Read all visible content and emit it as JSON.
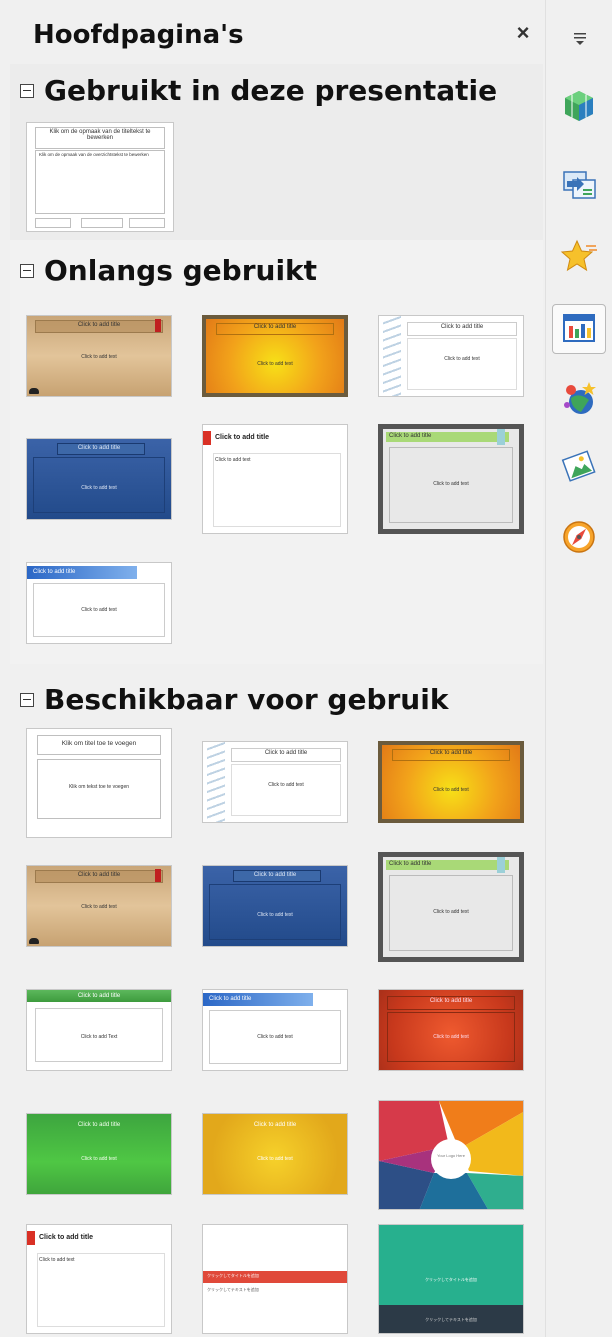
{
  "panel": {
    "title": "Hoofdpagina's",
    "close_glyph": "×"
  },
  "sections": {
    "used": {
      "label": "Gebruikt in deze presentatie"
    },
    "recent": {
      "label": "Onlangs gebruikt"
    },
    "available": {
      "label": "Beschikbaar voor gebruik"
    }
  },
  "thumb_text": {
    "click_add_title": "Click to add title",
    "click_add_text": "Click to add text",
    "click_add_text_caps": "Click to add Text",
    "nl_title": "Klik om de opmaak van de titeltekst te bewerken",
    "nl_body": "Klik om de opmaak van de overzichtstekst te bewerken",
    "nl_title_add": "Klik om titel toe te voegen",
    "nl_text_add": "Klik om tekst toe te voegen",
    "your_logo": "Your Logo Here",
    "jp_title": "クリックしてタイトルを追加",
    "jp_sub": "クリックしてテキストを追加",
    "text_body_short": "Click to add text"
  },
  "tabs": [
    {
      "name": "properties-icon"
    },
    {
      "name": "slide-transition-icon"
    },
    {
      "name": "animation-icon"
    },
    {
      "name": "master-slides-icon",
      "active": true
    },
    {
      "name": "styles-icon"
    },
    {
      "name": "gallery-icon"
    },
    {
      "name": "navigator-icon"
    }
  ]
}
